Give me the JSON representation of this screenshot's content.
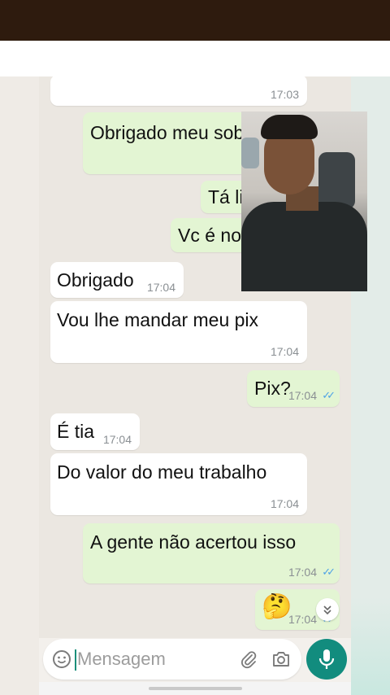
{
  "messages": [
    {
      "dir": "in",
      "text": "",
      "time": "17:03"
    },
    {
      "dir": "out",
      "text": "Obrigado meu sob",
      "time": "",
      "ticks": "✓✓"
    },
    {
      "dir": "out",
      "text": "Tá lin",
      "time": ""
    },
    {
      "dir": "out",
      "text": "Vc é no",
      "time": ""
    },
    {
      "dir": "in",
      "text": "Obrigado",
      "time": "17:04"
    },
    {
      "dir": "in",
      "text": "Vou lhe mandar meu pix",
      "time": "17:04"
    },
    {
      "dir": "out",
      "text": "Pix?",
      "time": "17:04",
      "ticks": "✓✓"
    },
    {
      "dir": "in",
      "text": "É tia",
      "time": "17:04"
    },
    {
      "dir": "in",
      "text": "Do valor do meu trabalho",
      "time": "17:04"
    },
    {
      "dir": "out",
      "text": "A gente não acertou isso",
      "time": "17:04",
      "ticks": "✓✓"
    },
    {
      "dir": "out",
      "text": "🤔",
      "time": "17:04",
      "ticks": "✓✓"
    }
  ],
  "composer": {
    "placeholder": "Mensagem",
    "value": ""
  },
  "icons": {
    "emoji": "emoji-icon",
    "attach": "paperclip-icon",
    "camera": "camera-icon",
    "mic": "microphone-icon",
    "scroll": "chevron-double-down-icon",
    "read": "double-check-icon"
  },
  "colors": {
    "incoming": "#ffffff",
    "outgoing": "#e3f5d3",
    "accent": "#128c7e",
    "read_ticks": "#4fa3e6",
    "wallpaper": "#ebe7e1",
    "top_bar": "#2e1b0e"
  }
}
